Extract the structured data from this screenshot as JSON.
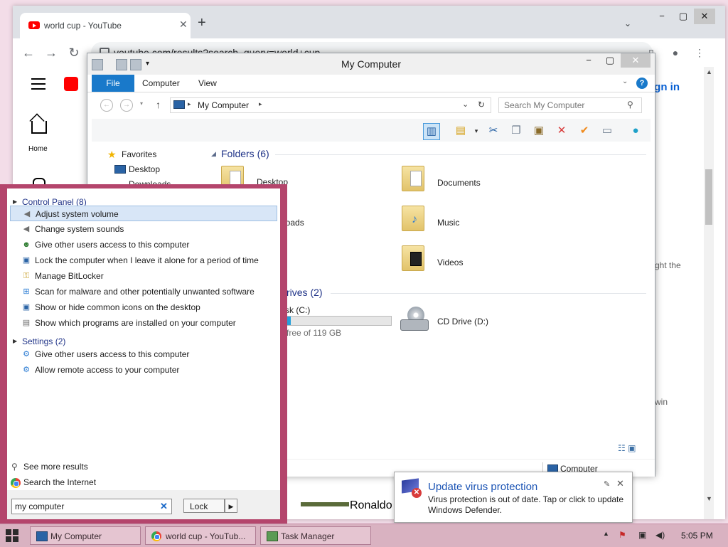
{
  "chrome": {
    "tab_title": "world cup - YouTube",
    "url": "youtube.com/results?search_query=world+cup",
    "home_label": "Home",
    "signin_label": "ign in",
    "side_text_1": "ght the",
    "side_text_2": "win",
    "ronaldo_text": "Ronaldo",
    "icons": {
      "back": "←",
      "forward": "→",
      "reload": "↻",
      "close": "✕",
      "new_tab": "+",
      "tab_search": "⌄",
      "minimize": "−",
      "maximize": "▢"
    }
  },
  "explorer": {
    "title": "My Computer",
    "ribbon_tabs": {
      "file": "File",
      "computer": "Computer",
      "view": "View"
    },
    "breadcrumb": "My Computer",
    "search_placeholder": "Search My Computer",
    "nav": {
      "favorites": "Favorites",
      "desktop": "Desktop",
      "downloads": "Downloads"
    },
    "folders_header": "Folders (6)",
    "folders": {
      "desktop": "Desktop",
      "downloads": "loads",
      "documents": "Documents",
      "music": "Music",
      "videos": "Videos"
    },
    "drives_header": "rives (2)",
    "drives": {
      "local_name": "sk (C:)",
      "local_free": "free of 119 GB",
      "local_used_fraction": 0.06,
      "cd_name": "CD Drive (D:)"
    },
    "status_computer": "Computer",
    "colors": {
      "file_tab": "#1979ca",
      "group_header": "#1e3287"
    }
  },
  "start": {
    "control_panel_header": "Control Panel (8)",
    "control_panel_items": [
      "Adjust system volume",
      "Change system sounds",
      "Give other users access to this computer",
      "Lock the computer when I leave it alone for a period of time",
      "Manage BitLocker",
      "Scan for malware and other potentially unwanted software",
      "Show or hide common icons on the desktop",
      "Show which programs are installed on your computer"
    ],
    "settings_header": "Settings (2)",
    "settings_items": [
      "Give other users access to this computer",
      "Allow remote access to your computer"
    ],
    "see_more": "See more results",
    "search_internet": "Search the Internet",
    "search_value": "my computer",
    "lock_label": "Lock",
    "border_color": "#b4456c"
  },
  "notification": {
    "title": "Update virus protection",
    "message": "Virus protection is out of date. Tap or click to update Windows Defender."
  },
  "taskbar": {
    "items": [
      "My Computer",
      "world cup - YouTub...",
      "Task Manager"
    ],
    "clock": "5:05 PM"
  }
}
